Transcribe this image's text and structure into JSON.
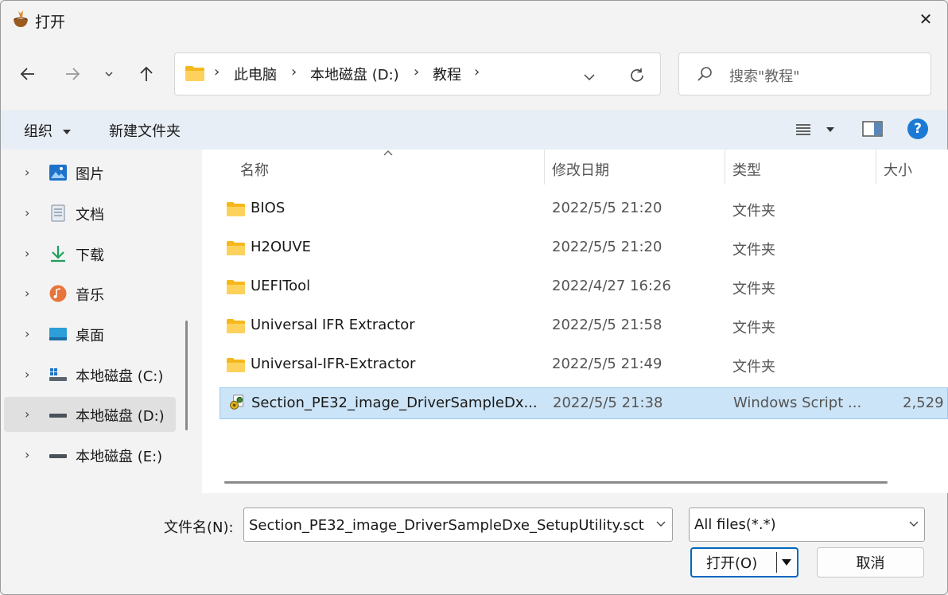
{
  "window": {
    "title": "打开",
    "close_glyph": "✕"
  },
  "nav": {
    "back_icon": "arrow-left-icon",
    "forward_icon": "arrow-right-icon",
    "recent_icon": "chevron-down-icon",
    "up_icon": "arrow-up-icon"
  },
  "breadcrumb": {
    "items": [
      "此电脑",
      "本地磁盘 (D:)",
      "教程"
    ],
    "separator": "›"
  },
  "search": {
    "placeholder": "搜索\"教程\""
  },
  "toolbar": {
    "organize": "组织",
    "new_folder": "新建文件夹",
    "help_glyph": "?"
  },
  "sidebar": {
    "items": [
      {
        "label": "图片",
        "icon": "pictures-icon"
      },
      {
        "label": "文档",
        "icon": "documents-icon"
      },
      {
        "label": "下载",
        "icon": "download-icon"
      },
      {
        "label": "音乐",
        "icon": "music-icon"
      },
      {
        "label": "桌面",
        "icon": "desktop-icon"
      },
      {
        "label": "本地磁盘 (C:)",
        "icon": "windows-drive-icon"
      },
      {
        "label": "本地磁盘 (D:)",
        "icon": "drive-icon",
        "selected": true
      },
      {
        "label": "本地磁盘 (E:)",
        "icon": "drive-icon"
      }
    ]
  },
  "columns": {
    "name": "名称",
    "date": "修改日期",
    "type": "类型",
    "size": "大小"
  },
  "files": [
    {
      "name": "BIOS",
      "date": "2022/5/5 21:20",
      "type": "文件夹",
      "size": "",
      "icon": "folder-icon"
    },
    {
      "name": "H2OUVE",
      "date": "2022/5/5 21:20",
      "type": "文件夹",
      "size": "",
      "icon": "folder-icon"
    },
    {
      "name": "UEFITool",
      "date": "2022/4/27 16:26",
      "type": "文件夹",
      "size": "",
      "icon": "folder-icon"
    },
    {
      "name": "Universal IFR Extractor",
      "date": "2022/5/5 21:58",
      "type": "文件夹",
      "size": "",
      "icon": "folder-icon"
    },
    {
      "name": "Universal-IFR-Extractor",
      "date": "2022/5/5 21:49",
      "type": "文件夹",
      "size": "",
      "icon": "folder-icon"
    },
    {
      "name": "Section_PE32_image_DriverSampleDx...",
      "date": "2022/5/5 21:38",
      "type": "Windows Script ...",
      "size": "2,529",
      "icon": "script-file-icon",
      "selected": true
    }
  ],
  "footer": {
    "filename_label": "文件名(N):",
    "filename_value": "Section_PE32_image_DriverSampleDxe_SetupUtility.sct",
    "filetype_value": "All files(*.*)",
    "open_label": "打开(O)",
    "cancel_label": "取消"
  },
  "colors": {
    "accent": "#0067c0",
    "selection": "#cce4f7",
    "folder": "#f8c84a"
  }
}
